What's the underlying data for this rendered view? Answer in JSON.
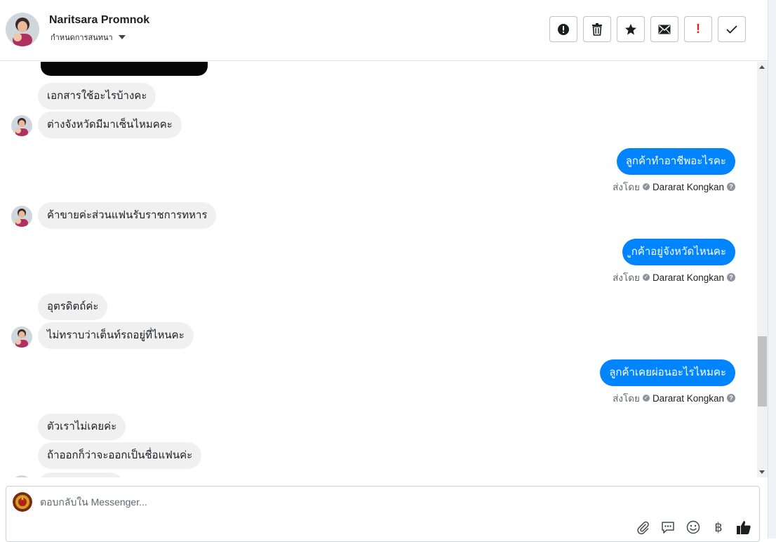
{
  "header": {
    "contact_name": "Naritsara Promnok",
    "assign_label": "กำหนดการสนทนา",
    "actions": [
      {
        "name": "spam-icon"
      },
      {
        "name": "trash-icon"
      },
      {
        "name": "star-icon"
      },
      {
        "name": "mail-icon"
      },
      {
        "name": "important-icon",
        "label": "!"
      },
      {
        "name": "done-check-icon"
      }
    ]
  },
  "messages": [
    {
      "from": "customer",
      "text": "เอกสารใช้อะไรบ้างคะ"
    },
    {
      "from": "customer",
      "text": "ต่างจังหวัดมีมาเซ็นไหมคคะ"
    },
    {
      "from": "page",
      "text": "ลูกค้าทำอาชีพอะไรคะ",
      "sent_by_label": "ส่งโดย",
      "agent": "Dararat Kongkan"
    },
    {
      "from": "customer",
      "text": "ค้าขายค่ะส่วนแฟนรับราชการทหาร"
    },
    {
      "from": "page",
      "text": "ูกค้าอยู่จังหวัดไหนคะ",
      "sent_by_label": "ส่งโดย",
      "agent": "Dararat Kongkan"
    },
    {
      "from": "customer",
      "text": "อุตรดิตถ์ค่ะ"
    },
    {
      "from": "customer",
      "text": "ไม่ทราบว่าเต็นท์รถอยู่ที่ไหนคะ"
    },
    {
      "from": "page",
      "text": "ลูกค้าเคยผ่อนอะไรไหมคะ",
      "sent_by_label": "ส่งโดย",
      "agent": "Dararat Kongkan"
    },
    {
      "from": "customer",
      "text": "ตัวเราไม่เคยค่ะ"
    },
    {
      "from": "customer",
      "text": "ถ้าออกก็ว่าจะออกเป็นชื่อแฟนค่ะ"
    }
  ],
  "composer": {
    "placeholder": "ตอบกลับใน Messenger...",
    "tools": [
      "paperclip-icon",
      "saved-reply-icon",
      "emoji-icon",
      "baht-icon",
      "thumbs-up-icon"
    ],
    "baht_symbol": "฿"
  },
  "colors": {
    "outgoing_bubble": "#0084ff",
    "incoming_bubble": "#f0f0f0",
    "important_red": "#e02020"
  }
}
